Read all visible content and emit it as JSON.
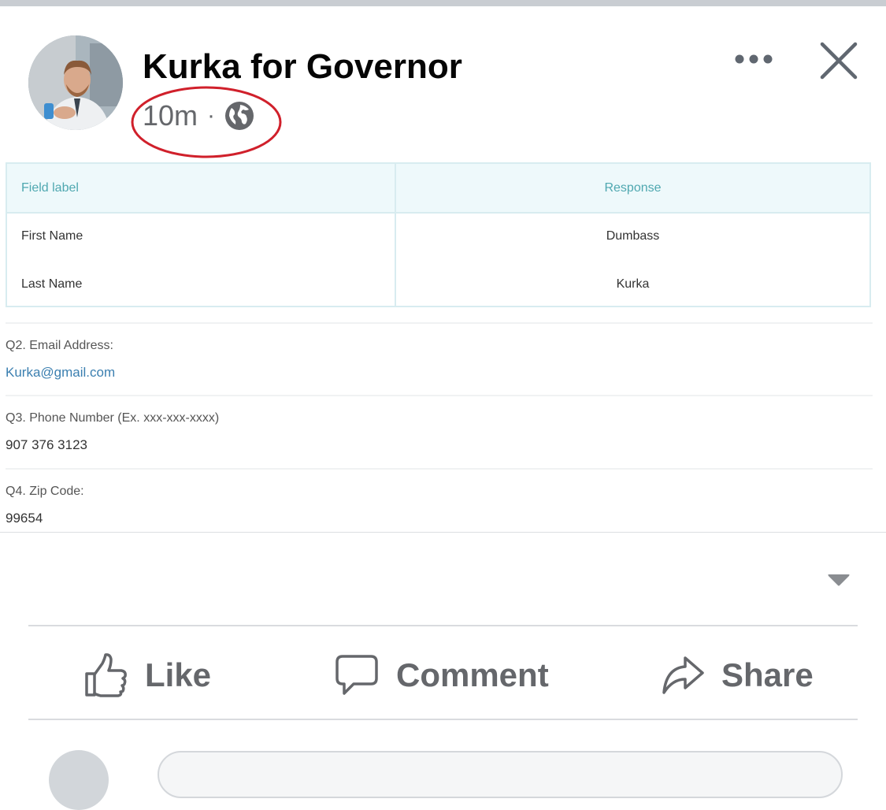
{
  "post": {
    "author": "Kurka for Governor",
    "time": "10m",
    "separator": "·",
    "privacy_icon": "globe-icon",
    "more_icon": "more-horizontal-icon",
    "close_icon": "close-icon",
    "annotation_color": "#d0202b"
  },
  "form": {
    "headers": {
      "label": "Field label",
      "response": "Response"
    },
    "rows": [
      {
        "label": "First Name",
        "value": "Dumbass"
      },
      {
        "label": "Last Name",
        "value": "Kurka"
      }
    ],
    "questions": [
      {
        "label": "Q2. Email Address:",
        "value": "Kurka@gmail.com"
      },
      {
        "label": "Q3. Phone Number (Ex. xxx-xxx-xxxx)",
        "value": "907 376 3123"
      },
      {
        "label": "Q4. Zip Code:",
        "value": "99654"
      }
    ],
    "accent": "#4fa8b0",
    "link_color": "#3b7fb0"
  },
  "actions": {
    "like": "Like",
    "comment": "Comment",
    "share": "Share"
  },
  "colors": {
    "action_gray": "#65676b",
    "divider": "#d9dbdf"
  }
}
